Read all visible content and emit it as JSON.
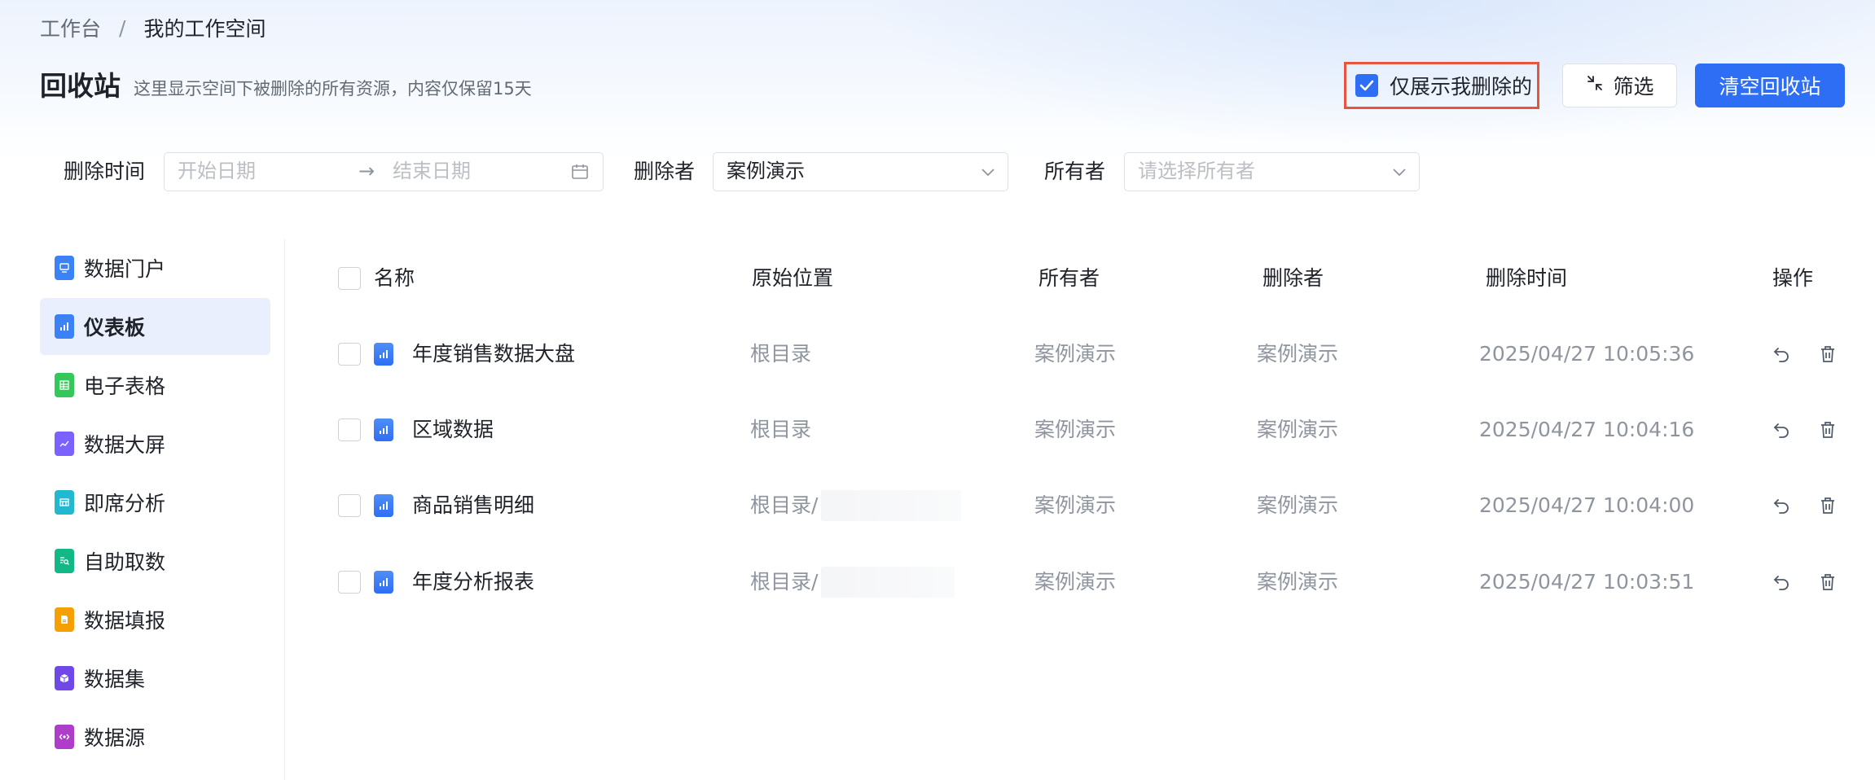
{
  "breadcrumb": {
    "root": "工作台",
    "separator": "/",
    "current": "我的工作空间"
  },
  "header": {
    "title": "回收站",
    "description": "这里显示空间下被删除的所有资源，内容仅保留15天",
    "only_mine_label": "仅展示我删除的",
    "only_mine_checked": true,
    "filter_label": "筛选",
    "clear_label": "清空回收站"
  },
  "filters": {
    "delete_time_label": "删除时间",
    "start_placeholder": "开始日期",
    "arrow": "→",
    "end_placeholder": "结束日期",
    "deleter_label": "删除者",
    "deleter_value": "案例演示",
    "owner_label": "所有者",
    "owner_placeholder": "请选择所有者"
  },
  "sidebar": {
    "items": [
      {
        "label": "数据门户",
        "icon": "portal-icon",
        "color": "#3b82f6"
      },
      {
        "label": "仪表板",
        "icon": "dashboard-icon",
        "color": "#3b82f6",
        "active": true
      },
      {
        "label": "电子表格",
        "icon": "spreadsheet-icon",
        "color": "#34c759"
      },
      {
        "label": "数据大屏",
        "icon": "big-screen-icon",
        "color": "#7b61ff"
      },
      {
        "label": "即席分析",
        "icon": "adhoc-analysis-icon",
        "color": "#22b8cf"
      },
      {
        "label": "自助取数",
        "icon": "self-service-icon",
        "color": "#12b886"
      },
      {
        "label": "数据填报",
        "icon": "data-entry-icon",
        "color": "#f59f00"
      },
      {
        "label": "数据集",
        "icon": "dataset-icon",
        "color": "#7048e8"
      },
      {
        "label": "数据源",
        "icon": "datasource-icon",
        "color": "#ae3ec9"
      }
    ]
  },
  "table": {
    "columns": [
      "名称",
      "原始位置",
      "所有者",
      "删除者",
      "删除时间",
      "操作"
    ],
    "rows": [
      {
        "name": "年度销售数据大盘",
        "location": "根目录",
        "owner": "案例演示",
        "deleter": "案例演示",
        "time": "2025/04/27 10:05:36"
      },
      {
        "name": "区域数据",
        "location": "根目录",
        "owner": "案例演示",
        "deleter": "案例演示",
        "time": "2025/04/27 10:04:16"
      },
      {
        "name": "商品销售明细",
        "location": "根目录/",
        "owner": "案例演示",
        "deleter": "案例演示",
        "time": "2025/04/27 10:04:00"
      },
      {
        "name": "年度分析报表",
        "location": "根目录/",
        "owner": "案例演示",
        "deleter": "案例演示",
        "time": "2025/04/27 10:03:51"
      }
    ]
  },
  "colors": {
    "primary": "#2e6ef5",
    "highlight_border": "#e8553f",
    "muted_text": "#8f959e"
  }
}
